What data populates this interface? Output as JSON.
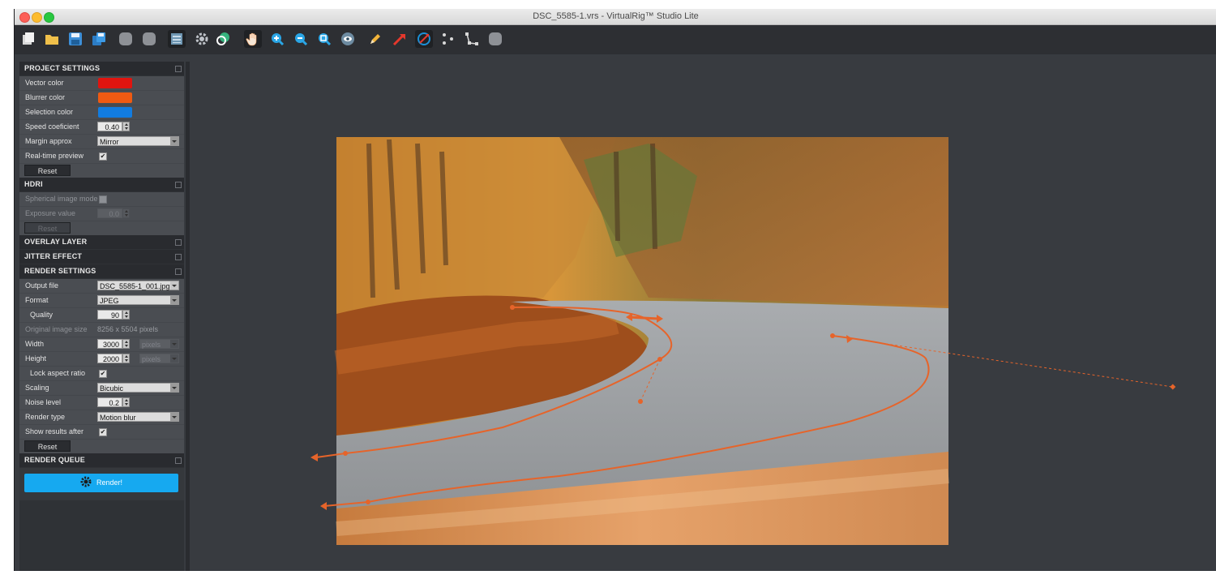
{
  "window": {
    "title": "DSC_5585-1.vrs - VirtualRig™ Studio Lite"
  },
  "toolbar": {
    "icons": [
      "new-icon",
      "open-folder-icon",
      "save-icon",
      "save-copy-icon",
      "gray-circle-icon",
      "gray-circle-icon",
      "layers-icon",
      "settings-gear-icon",
      "transform-icon",
      "hand-pan-icon",
      "zoom-in-icon",
      "zoom-out-icon",
      "zoom-fit-icon",
      "eye-preview-icon",
      "pencil-icon",
      "vector-arrow-icon",
      "rotate-vector-icon",
      "points-icon",
      "path-edit-icon",
      "gray-circle-icon"
    ]
  },
  "colors": {
    "vector": "#e0140f",
    "blurrer": "#ef5a12",
    "selection": "#127ce0",
    "render_button": "#16a9f0",
    "overlay_curve": "#e6642a"
  },
  "project_settings": {
    "title": "PROJECT SETTINGS",
    "vector_color_label": "Vector color",
    "blurrer_color_label": "Blurrer color",
    "selection_color_label": "Selection color",
    "speed_label": "Speed coeficient",
    "speed_value": "0.40",
    "margin_label": "Margin approx",
    "margin_value": "Mirror",
    "realtime_label": "Real-time preview",
    "realtime_checked": "✔",
    "reset_label": "Reset"
  },
  "hdri": {
    "title": "HDRI",
    "spherical_label": "Spherical image mode",
    "exposure_label": "Exposure value",
    "exposure_value": "0.0",
    "reset_label": "Reset"
  },
  "overlay": {
    "title": "OVERLAY LAYER"
  },
  "jitter": {
    "title": "JITTER EFFECT"
  },
  "render_settings": {
    "title": "RENDER SETTINGS",
    "output_label": "Output file",
    "output_value": "DSC_5585-1_001.jpg",
    "format_label": "Format",
    "format_value": "JPEG",
    "quality_label": "Quality",
    "quality_value": "90",
    "orig_size_label": "Original image size",
    "orig_size_value": "8256 x 5504 pixels",
    "width_label": "Width",
    "width_value": "3000",
    "width_unit": "pixels",
    "height_label": "Height",
    "height_value": "2000",
    "height_unit": "pixels",
    "lock_label": "Lock aspect ratio",
    "lock_checked": "✔",
    "scaling_label": "Scaling",
    "scaling_value": "Bicubic",
    "noise_label": "Noise level",
    "noise_value": "0.2",
    "render_type_label": "Render type",
    "render_type_value": "Motion blur",
    "show_results_label": "Show results after",
    "show_results_checked": "✔",
    "reset_label": "Reset"
  },
  "render_queue": {
    "title": "RENDER QUEUE",
    "render_label": "Render!"
  }
}
